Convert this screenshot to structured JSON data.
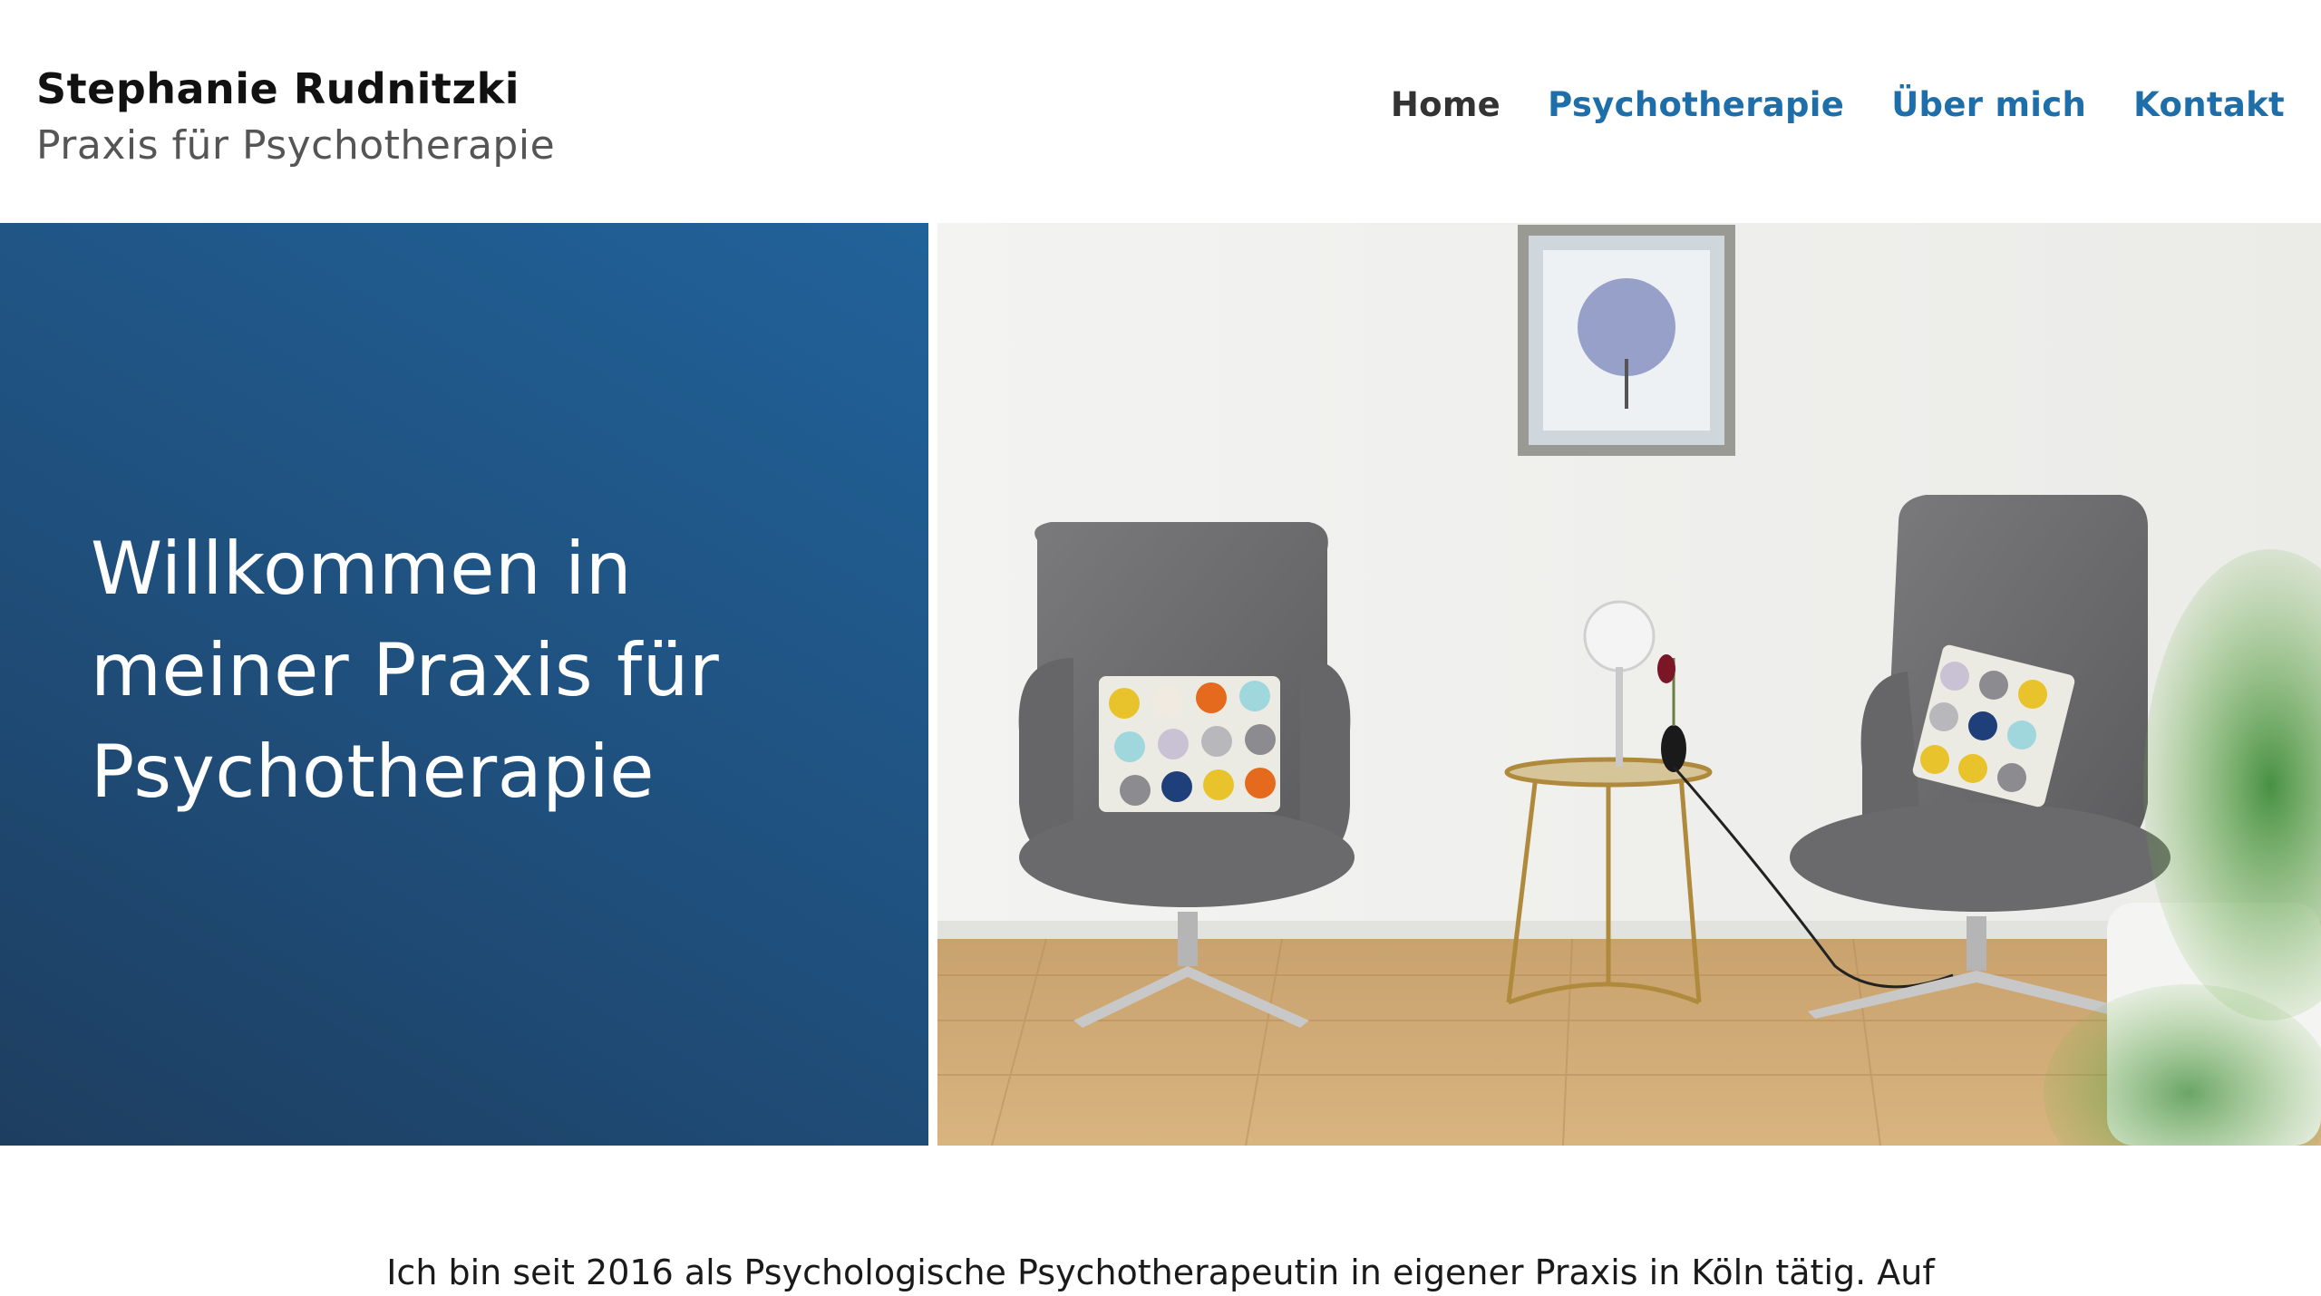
{
  "brand": {
    "name": "Stephanie Rudnitzki",
    "tagline": "Praxis für Psychotherapie"
  },
  "nav": {
    "items": [
      {
        "label": "Home",
        "active": true
      },
      {
        "label": "Psychotherapie",
        "active": false
      },
      {
        "label": "Über mich",
        "active": false
      },
      {
        "label": "Kontakt",
        "active": false
      }
    ]
  },
  "hero": {
    "title_lines": [
      "Willkommen in",
      "meiner Praxis für",
      "Psychotherapie"
    ]
  },
  "intro": {
    "text": "Ich bin seit 2016 als Psychologische Psychotherapeutin in eigener Praxis in Köln tätig. Auf"
  },
  "colors": {
    "accent": "#1e6eaa",
    "hero_panel": "#1f4f7c",
    "nav_active": "#333333"
  }
}
